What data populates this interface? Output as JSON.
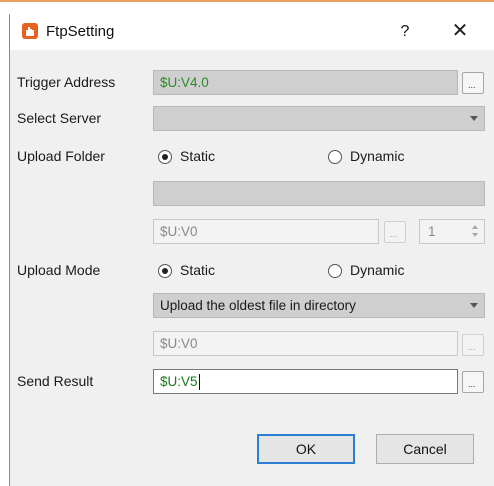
{
  "window": {
    "title": "FtpSetting",
    "help_label": "?",
    "close_label": "✕",
    "icon": "app-hand-icon"
  },
  "trigger_address": {
    "label": "Trigger Address",
    "value": "$U:V4.0",
    "browse_label": "..."
  },
  "select_server": {
    "label": "Select Server",
    "value": ""
  },
  "upload_folder": {
    "label": "Upload Folder",
    "static_label": "Static",
    "dynamic_label": "Dynamic",
    "selected": "Static",
    "static_value": "",
    "address_value": "$U:V0",
    "browse_label": "...",
    "count_value": "1"
  },
  "upload_mode": {
    "label": "Upload Mode",
    "static_label": "Static",
    "dynamic_label": "Dynamic",
    "selected": "Static",
    "mode_value": "Upload the oldest file in directory",
    "address_value": "$U:V0",
    "browse_label": "..."
  },
  "send_result": {
    "label": "Send Result",
    "value": "$U:V5",
    "browse_label": "..."
  },
  "buttons": {
    "ok": "OK",
    "cancel": "Cancel"
  },
  "colors": {
    "accent": "#2a7fd4",
    "value_green": "#2b8a2b",
    "title_icon": "#e8621f"
  }
}
